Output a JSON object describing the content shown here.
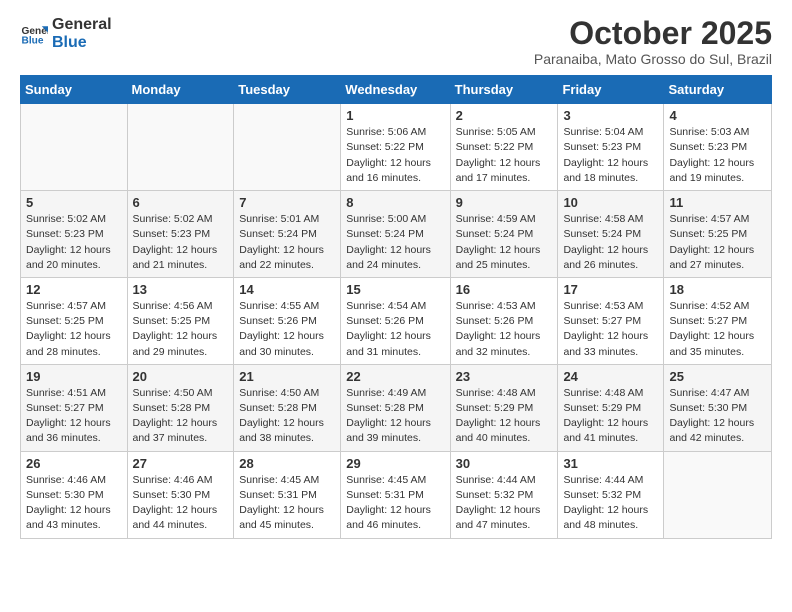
{
  "logo": {
    "text_general": "General",
    "text_blue": "Blue"
  },
  "title": "October 2025",
  "subtitle": "Paranaiba, Mato Grosso do Sul, Brazil",
  "weekdays": [
    "Sunday",
    "Monday",
    "Tuesday",
    "Wednesday",
    "Thursday",
    "Friday",
    "Saturday"
  ],
  "weeks": [
    [
      {
        "day": "",
        "info": ""
      },
      {
        "day": "",
        "info": ""
      },
      {
        "day": "",
        "info": ""
      },
      {
        "day": "1",
        "info": "Sunrise: 5:06 AM\nSunset: 5:22 PM\nDaylight: 12 hours and 16 minutes."
      },
      {
        "day": "2",
        "info": "Sunrise: 5:05 AM\nSunset: 5:22 PM\nDaylight: 12 hours and 17 minutes."
      },
      {
        "day": "3",
        "info": "Sunrise: 5:04 AM\nSunset: 5:23 PM\nDaylight: 12 hours and 18 minutes."
      },
      {
        "day": "4",
        "info": "Sunrise: 5:03 AM\nSunset: 5:23 PM\nDaylight: 12 hours and 19 minutes."
      }
    ],
    [
      {
        "day": "5",
        "info": "Sunrise: 5:02 AM\nSunset: 5:23 PM\nDaylight: 12 hours and 20 minutes."
      },
      {
        "day": "6",
        "info": "Sunrise: 5:02 AM\nSunset: 5:23 PM\nDaylight: 12 hours and 21 minutes."
      },
      {
        "day": "7",
        "info": "Sunrise: 5:01 AM\nSunset: 5:24 PM\nDaylight: 12 hours and 22 minutes."
      },
      {
        "day": "8",
        "info": "Sunrise: 5:00 AM\nSunset: 5:24 PM\nDaylight: 12 hours and 24 minutes."
      },
      {
        "day": "9",
        "info": "Sunrise: 4:59 AM\nSunset: 5:24 PM\nDaylight: 12 hours and 25 minutes."
      },
      {
        "day": "10",
        "info": "Sunrise: 4:58 AM\nSunset: 5:24 PM\nDaylight: 12 hours and 26 minutes."
      },
      {
        "day": "11",
        "info": "Sunrise: 4:57 AM\nSunset: 5:25 PM\nDaylight: 12 hours and 27 minutes."
      }
    ],
    [
      {
        "day": "12",
        "info": "Sunrise: 4:57 AM\nSunset: 5:25 PM\nDaylight: 12 hours and 28 minutes."
      },
      {
        "day": "13",
        "info": "Sunrise: 4:56 AM\nSunset: 5:25 PM\nDaylight: 12 hours and 29 minutes."
      },
      {
        "day": "14",
        "info": "Sunrise: 4:55 AM\nSunset: 5:26 PM\nDaylight: 12 hours and 30 minutes."
      },
      {
        "day": "15",
        "info": "Sunrise: 4:54 AM\nSunset: 5:26 PM\nDaylight: 12 hours and 31 minutes."
      },
      {
        "day": "16",
        "info": "Sunrise: 4:53 AM\nSunset: 5:26 PM\nDaylight: 12 hours and 32 minutes."
      },
      {
        "day": "17",
        "info": "Sunrise: 4:53 AM\nSunset: 5:27 PM\nDaylight: 12 hours and 33 minutes."
      },
      {
        "day": "18",
        "info": "Sunrise: 4:52 AM\nSunset: 5:27 PM\nDaylight: 12 hours and 35 minutes."
      }
    ],
    [
      {
        "day": "19",
        "info": "Sunrise: 4:51 AM\nSunset: 5:27 PM\nDaylight: 12 hours and 36 minutes."
      },
      {
        "day": "20",
        "info": "Sunrise: 4:50 AM\nSunset: 5:28 PM\nDaylight: 12 hours and 37 minutes."
      },
      {
        "day": "21",
        "info": "Sunrise: 4:50 AM\nSunset: 5:28 PM\nDaylight: 12 hours and 38 minutes."
      },
      {
        "day": "22",
        "info": "Sunrise: 4:49 AM\nSunset: 5:28 PM\nDaylight: 12 hours and 39 minutes."
      },
      {
        "day": "23",
        "info": "Sunrise: 4:48 AM\nSunset: 5:29 PM\nDaylight: 12 hours and 40 minutes."
      },
      {
        "day": "24",
        "info": "Sunrise: 4:48 AM\nSunset: 5:29 PM\nDaylight: 12 hours and 41 minutes."
      },
      {
        "day": "25",
        "info": "Sunrise: 4:47 AM\nSunset: 5:30 PM\nDaylight: 12 hours and 42 minutes."
      }
    ],
    [
      {
        "day": "26",
        "info": "Sunrise: 4:46 AM\nSunset: 5:30 PM\nDaylight: 12 hours and 43 minutes."
      },
      {
        "day": "27",
        "info": "Sunrise: 4:46 AM\nSunset: 5:30 PM\nDaylight: 12 hours and 44 minutes."
      },
      {
        "day": "28",
        "info": "Sunrise: 4:45 AM\nSunset: 5:31 PM\nDaylight: 12 hours and 45 minutes."
      },
      {
        "day": "29",
        "info": "Sunrise: 4:45 AM\nSunset: 5:31 PM\nDaylight: 12 hours and 46 minutes."
      },
      {
        "day": "30",
        "info": "Sunrise: 4:44 AM\nSunset: 5:32 PM\nDaylight: 12 hours and 47 minutes."
      },
      {
        "day": "31",
        "info": "Sunrise: 4:44 AM\nSunset: 5:32 PM\nDaylight: 12 hours and 48 minutes."
      },
      {
        "day": "",
        "info": ""
      }
    ]
  ]
}
